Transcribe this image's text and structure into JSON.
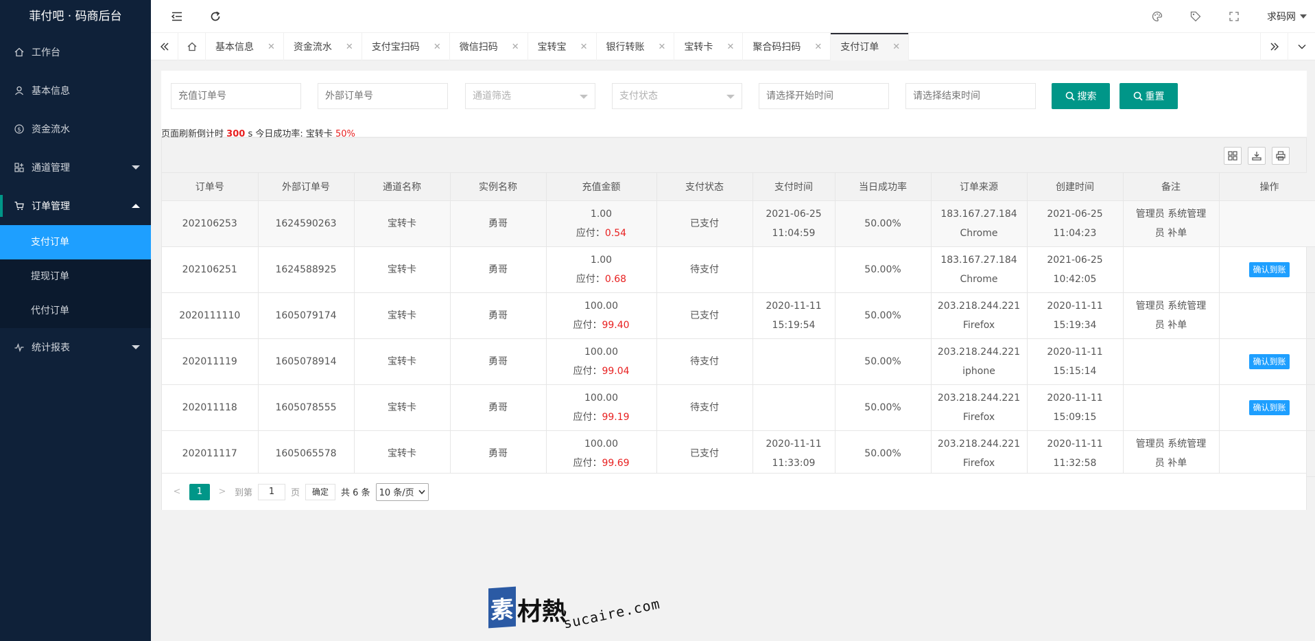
{
  "brand": "菲付吧 · 码商后台",
  "sidebar": {
    "items": [
      {
        "label": "工作台",
        "icon": "home-icon"
      },
      {
        "label": "基本信息",
        "icon": "user-icon"
      },
      {
        "label": "资金流水",
        "icon": "dollar-icon"
      },
      {
        "label": "通道管理",
        "icon": "apps-icon"
      },
      {
        "label": "订单管理",
        "icon": "cart-icon"
      },
      {
        "label": "统计报表",
        "icon": "chart-icon"
      }
    ],
    "sub_items": [
      "支付订单",
      "提现订单",
      "代付订单"
    ]
  },
  "header": {
    "user": "求码网"
  },
  "tabs": [
    "基本信息",
    "资金流水",
    "支付宝扫码",
    "微信扫码",
    "宝转宝",
    "银行转账",
    "宝转卡",
    "聚合码扫码",
    "支付订单"
  ],
  "filters": {
    "order_no_placeholder": "充值订单号",
    "external_no_placeholder": "外部订单号",
    "channel_placeholder": "通道筛选",
    "status_placeholder": "支付状态",
    "start_placeholder": "请选择开始时间",
    "end_placeholder": "请选择结束时间",
    "search_label": "搜索",
    "reset_label": "重置"
  },
  "refresh": {
    "prefix": "页面刷新倒计时",
    "seconds": "300",
    "mid": "s 今日成功率: 宝转卡",
    "rate": "50%"
  },
  "table": {
    "columns": [
      "订单号",
      "外部订单号",
      "通道名称",
      "实例名称",
      "充值金额",
      "支付状态",
      "支付时间",
      "当日成功率",
      "订单来源",
      "创建时间",
      "备注",
      "操作"
    ],
    "pay_prefix": "应付：",
    "rows": [
      {
        "order": "202106253",
        "ext": "1624590263",
        "channel": "宝转卡",
        "instance": "勇哥",
        "amount": "1.00",
        "pay": "0.54",
        "status": "已支付",
        "pay_date": "2021-06-25",
        "pay_time": "11:04:59",
        "rate": "50.00%",
        "ip": "183.167.27.184",
        "ua": "Chrome",
        "c_date": "2021-06-25",
        "c_time": "11:04:23",
        "remark1": "管理员 系统管理",
        "remark2": "员 补单",
        "action": ""
      },
      {
        "order": "202106251",
        "ext": "1624588925",
        "channel": "宝转卡",
        "instance": "勇哥",
        "amount": "1.00",
        "pay": "0.68",
        "status": "待支付",
        "pay_date": "",
        "pay_time": "",
        "rate": "50.00%",
        "ip": "183.167.27.184",
        "ua": "Chrome",
        "c_date": "2021-06-25",
        "c_time": "10:42:05",
        "remark1": "",
        "remark2": "",
        "action": "确认到账"
      },
      {
        "order": "2020111110",
        "ext": "1605079174",
        "channel": "宝转卡",
        "instance": "勇哥",
        "amount": "100.00",
        "pay": "99.40",
        "status": "已支付",
        "pay_date": "2020-11-11",
        "pay_time": "15:19:54",
        "rate": "50.00%",
        "ip": "203.218.244.221",
        "ua": "Firefox",
        "c_date": "2020-11-11",
        "c_time": "15:19:34",
        "remark1": "管理员 系统管理",
        "remark2": "员 补单",
        "action": ""
      },
      {
        "order": "202011119",
        "ext": "1605078914",
        "channel": "宝转卡",
        "instance": "勇哥",
        "amount": "100.00",
        "pay": "99.04",
        "status": "待支付",
        "pay_date": "",
        "pay_time": "",
        "rate": "50.00%",
        "ip": "203.218.244.221",
        "ua": "iphone",
        "c_date": "2020-11-11",
        "c_time": "15:15:14",
        "remark1": "",
        "remark2": "",
        "action": "确认到账"
      },
      {
        "order": "202011118",
        "ext": "1605078555",
        "channel": "宝转卡",
        "instance": "勇哥",
        "amount": "100.00",
        "pay": "99.19",
        "status": "待支付",
        "pay_date": "",
        "pay_time": "",
        "rate": "50.00%",
        "ip": "203.218.244.221",
        "ua": "Firefox",
        "c_date": "2020-11-11",
        "c_time": "15:09:15",
        "remark1": "",
        "remark2": "",
        "action": "确认到账"
      },
      {
        "order": "202011117",
        "ext": "1605065578",
        "channel": "宝转卡",
        "instance": "勇哥",
        "amount": "100.00",
        "pay": "99.69",
        "status": "已支付",
        "pay_date": "2020-11-11",
        "pay_time": "11:33:09",
        "rate": "50.00%",
        "ip": "203.218.244.221",
        "ua": "Firefox",
        "c_date": "2020-11-11",
        "c_time": "11:32:58",
        "remark1": "管理员 系统管理",
        "remark2": "员 补单",
        "action": ""
      }
    ]
  },
  "pager": {
    "current": "1",
    "goto_label": "到第",
    "goto_value": "1",
    "page_label": "页",
    "ok_label": "确定",
    "total": "共 6 条",
    "size": "10 条/页"
  },
  "watermark": {
    "box": "素",
    "cn": "材熱",
    "en": "sucaire.com"
  },
  "colors": {
    "sidebar_bg": "#0f2139",
    "active_blue": "#1e9fff",
    "teal": "#009688",
    "red": "#e82020"
  }
}
